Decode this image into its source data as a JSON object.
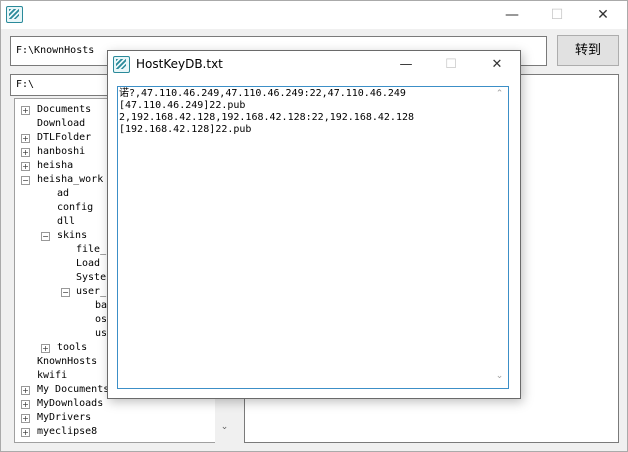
{
  "main": {
    "path_value": "F:\\KnownHosts",
    "goto_label": "转到",
    "drive": "F:\\",
    "window_buttons": {
      "minimize": "—",
      "maximize": "☐",
      "close": "✕"
    }
  },
  "tree": {
    "items": [
      {
        "label": "Documents",
        "expander": "+"
      },
      {
        "label": "Download",
        "expander": ""
      },
      {
        "label": "DTLFolder",
        "expander": "+"
      },
      {
        "label": "hanboshi",
        "expander": "+"
      },
      {
        "label": "heisha",
        "expander": "+"
      },
      {
        "label": "heisha_work",
        "expander": "−"
      },
      {
        "label": "ad",
        "expander": ""
      },
      {
        "label": "config",
        "expander": ""
      },
      {
        "label": "dll",
        "expander": ""
      },
      {
        "label": "skins",
        "expander": "−"
      },
      {
        "label": "file_i",
        "expander": ""
      },
      {
        "label": "Load",
        "expander": ""
      },
      {
        "label": "Syster",
        "expander": ""
      },
      {
        "label": "user_s",
        "expander": "−"
      },
      {
        "label": "ba",
        "expander": ""
      },
      {
        "label": "os",
        "expander": ""
      },
      {
        "label": "us",
        "expander": ""
      },
      {
        "label": "tools",
        "expander": "+"
      },
      {
        "label": "KnownHosts",
        "expander": ""
      },
      {
        "label": "kwifi",
        "expander": ""
      },
      {
        "label": "My Documents",
        "expander": "+"
      },
      {
        "label": "MyDownloads",
        "expander": "+"
      },
      {
        "label": "MyDrivers",
        "expander": "+"
      },
      {
        "label": "myeclipse8",
        "expander": "+"
      }
    ],
    "scroll_up": "▲",
    "scroll_down": "⌄"
  },
  "dialog": {
    "title": "HostKeyDB.txt",
    "buttons": {
      "minimize": "—",
      "maximize": "☐",
      "close": "✕"
    },
    "lines": [
      "诺?,47.110.46.249,47.110.46.249:22,47.110.46.249",
      "[47.110.46.249]22.pub",
      "2,192.168.42.128,192.168.42.128:22,192.168.42.128",
      "[192.168.42.128]22.pub"
    ],
    "scroll_up": "⌃",
    "scroll_down": "⌄"
  },
  "colors": {
    "focus_border": "#3c8fc7",
    "icon": "#2a8a9a"
  }
}
